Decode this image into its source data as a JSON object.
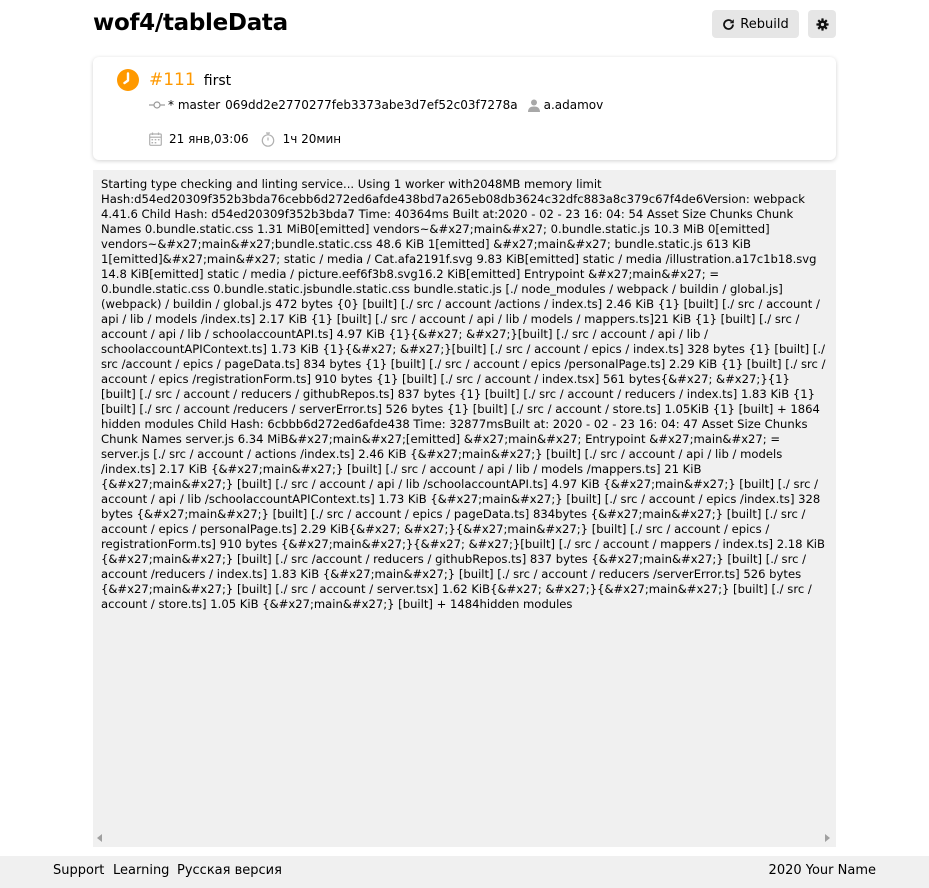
{
  "header": {
    "repo_title": "wof4/tableData",
    "rebuild_label": "Rebuild"
  },
  "build": {
    "number": "#111",
    "message": "first",
    "branch": "* master",
    "commit_hash": "069dd2e2770277feb3373abe3d7ef52c03f7278a",
    "author": "a.adamov",
    "date": "21 янв,03:06",
    "duration": "1ч 20мин",
    "status_color": "#ff9900"
  },
  "log": {
    "text": "Starting type checking and linting service... Using 1 worker with2048MB memory limit Hash:d54ed20309f352b3bda76cebb6d272ed6afde438bd7a265eb08db3624c32dfc883a8c379c67f4de6Version: webpack 4.41.6 Child Hash: d54ed20309f352b3bda7 Time: 40364ms Built at:2020 - 02 - 23 16: 04: 54 Asset Size Chunks Chunk Names 0.bundle.static.css 1.31 MiB0[emitted] vendors~&#x27;main&#x27; 0.bundle.static.js 10.3 MiB 0[emitted] vendors~&#x27;main&#x27;bundle.static.css 48.6 KiB 1[emitted] &#x27;main&#x27; bundle.static.js 613 KiB 1[emitted]&#x27;main&#x27; static / media / Cat.afa2191f.svg 9.83 KiB[emitted] static / media /illustration.a17c1b18.svg 14.8 KiB[emitted] static / media / picture.eef6f3b8.svg16.2 KiB[emitted] Entrypoint &#x27;main&#x27; = 0.bundle.static.css 0.bundle.static.jsbundle.static.css bundle.static.js [./ node_modules / webpack / buildin / global.js] (webpack) / buildin / global.js 472 bytes {0} [built] [./ src / account /actions / index.ts] 2.46 KiB {1} [built] [./ src / account / api / lib / models /index.ts] 2.17 KiB {1} [built] [./ src / account / api / lib / models / mappers.ts]21 KiB {1} [built] [./ src / account / api / lib / schoolaccountAPI.ts] 4.97 KiB {1}{&#x27; &#x27;}[built] [./ src / account / api / lib / schoolaccountAPIContext.ts] 1.73 KiB {1}{&#x27; &#x27;}[built] [./ src / account / epics / index.ts] 328 bytes {1} [built] [./ src /account / epics / pageData.ts] 834 bytes {1} [built] [./ src / account / epics /personalPage.ts] 2.29 KiB {1} [built] [./ src / account / epics /registrationForm.ts] 910 bytes {1} [built] [./ src / account / index.tsx] 561 bytes{&#x27; &#x27;}{1} [built] [./ src / account / reducers / githubRepos.ts] 837 bytes {1} [built] [./ src / account / reducers / index.ts] 1.83 KiB {1} [built] [./ src / account /reducers / serverError.ts] 526 bytes {1} [built] [./ src / account / store.ts] 1.05KiB {1} [built] + 1864 hidden modules Child Hash: 6cbbb6d272ed6afde438 Time: 32877msBuilt at: 2020 - 02 - 23 16: 04: 47 Asset Size Chunks Chunk Names server.js 6.34 MiB&#x27;main&#x27;[emitted] &#x27;main&#x27; Entrypoint &#x27;main&#x27; = server.js [./ src / account / actions /index.ts] 2.46 KiB {&#x27;main&#x27;} [built] [./ src / account / api / lib / models /index.ts] 2.17 KiB {&#x27;main&#x27;} [built] [./ src / account / api / lib / models /mappers.ts] 21 KiB {&#x27;main&#x27;} [built] [./ src / account / api / lib /schoolaccountAPI.ts] 4.97 KiB {&#x27;main&#x27;} [built] [./ src / account / api / lib /schoolaccountAPIContext.ts] 1.73 KiB {&#x27;main&#x27;} [built] [./ src / account / epics /index.ts] 328 bytes {&#x27;main&#x27;} [built] [./ src / account / epics / pageData.ts] 834bytes {&#x27;main&#x27;} [built] [./ src / account / epics / personalPage.ts] 2.29 KiB{&#x27; &#x27;}{&#x27;main&#x27;} [built] [./ src / account / epics / registrationForm.ts] 910 bytes {&#x27;main&#x27;}{&#x27; &#x27;}[built] [./ src / account / mappers / index.ts] 2.18 KiB {&#x27;main&#x27;} [built] [./ src /account / reducers / githubRepos.ts] 837 bytes {&#x27;main&#x27;} [built] [./ src / account /reducers / index.ts] 1.83 KiB {&#x27;main&#x27;} [built] [./ src / account / reducers /serverError.ts] 526 bytes {&#x27;main&#x27;} [built] [./ src / account / server.tsx] 1.62 KiB{&#x27; &#x27;}{&#x27;main&#x27;} [built] [./ src / account / store.ts] 1.05 KiB {&#x27;main&#x27;} [built] + 1484hidden modules"
  },
  "footer": {
    "support": "Support",
    "learning": "Learning",
    "russian": "Русская версия",
    "copyright": "2020 Your Name"
  },
  "icons": {
    "status": "clock-icon",
    "rebuild": "refresh-icon",
    "settings": "gear-icon",
    "branch": "commit-icon",
    "author": "user-icon",
    "date": "calendar-icon",
    "duration": "stopwatch-icon"
  }
}
